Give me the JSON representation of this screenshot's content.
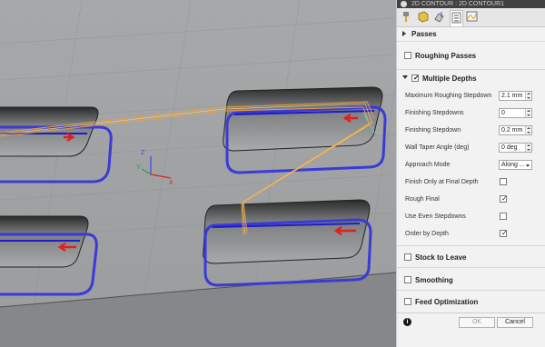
{
  "window": {
    "title": "2D CONTOUR : 2D CONTOUR1"
  },
  "tabs": [
    {
      "icon": "tool-icon"
    },
    {
      "icon": "geometry-icon"
    },
    {
      "icon": "heights-icon"
    },
    {
      "icon": "passes-icon",
      "active": true
    },
    {
      "icon": "linking-icon"
    }
  ],
  "sections": {
    "passes": "Passes",
    "roughing_passes": "Roughing Passes",
    "multiple_depths": "Multiple Depths",
    "stock_to_leave": "Stock to Leave",
    "smoothing": "Smoothing",
    "feed_optimization": "Feed Optimization"
  },
  "multiple_depths_checked": true,
  "fields": {
    "max_roughing_stepdown": {
      "label": "Maximum Roughing Stepdown",
      "value": "2.1 mm"
    },
    "finishing_stepdowns": {
      "label": "Finishing Stepdowns",
      "value": "0"
    },
    "finishing_stepdown": {
      "label": "Finishing Stepdown",
      "value": "0.2 mm"
    },
    "wall_taper_angle": {
      "label": "Wall Taper Angle (deg)",
      "value": "0 deg"
    },
    "approach_mode": {
      "label": "Approach Mode",
      "value": "Along ..."
    },
    "finish_only_final": {
      "label": "Finish Only at Final Depth",
      "checked": false
    },
    "rough_final": {
      "label": "Rough Final",
      "checked": true
    },
    "use_even_stepdowns": {
      "label": "Use Even Stepdowns",
      "checked": false
    },
    "order_by_depth": {
      "label": "Order by Depth",
      "checked": true
    }
  },
  "buttons": {
    "ok": "OK",
    "cancel": "Cancel"
  },
  "triad": {
    "z": "Z",
    "y": "Y",
    "x": "X"
  },
  "colors": {
    "toolpath_blue": "#3a3ad8",
    "plunge_red": "#e02020",
    "link_orange": "#e8a040"
  }
}
